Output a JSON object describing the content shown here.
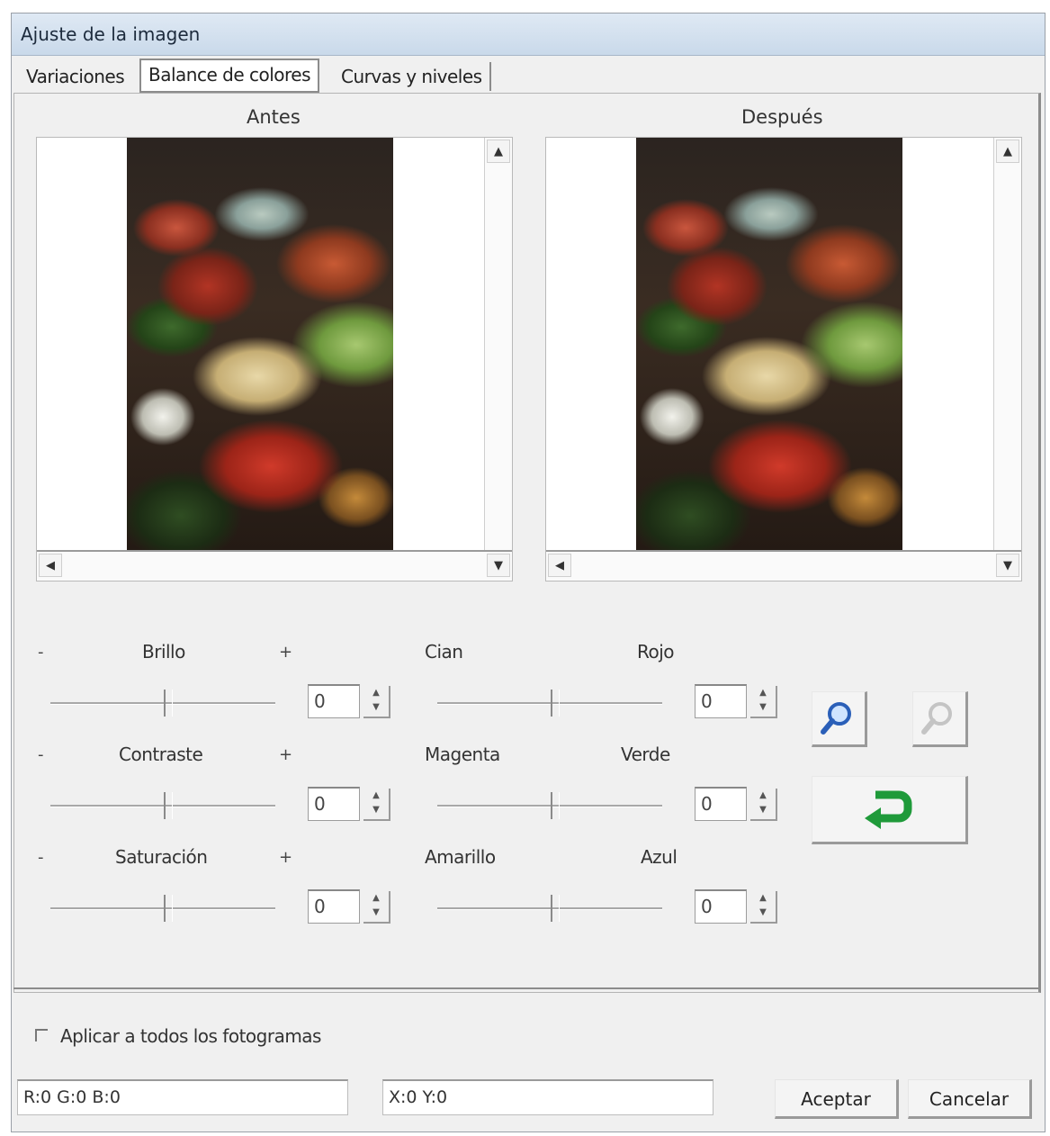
{
  "window": {
    "title": "Ajuste de la imagen"
  },
  "tabs": [
    {
      "label": "Variaciones",
      "active": false
    },
    {
      "label": "Balance de colores",
      "active": true
    },
    {
      "label": "Curvas y niveles",
      "active": false
    }
  ],
  "preview": {
    "before_label": "Antes",
    "after_label": "Después"
  },
  "adjustments": {
    "brightness": {
      "label": "Brillo",
      "minus": "-",
      "plus": "+",
      "value": "0"
    },
    "contrast": {
      "label": "Contraste",
      "minus": "-",
      "plus": "+",
      "value": "0"
    },
    "saturation": {
      "label": "Saturación",
      "minus": "-",
      "plus": "+",
      "value": "0"
    },
    "cyan_red": {
      "left": "Cian",
      "right": "Rojo",
      "value": "0"
    },
    "magenta_green": {
      "left": "Magenta",
      "right": "Verde",
      "value": "0"
    },
    "yellow_blue": {
      "left": "Amarillo",
      "right": "Azul",
      "value": "0"
    }
  },
  "apply_all": {
    "label": "Aplicar a todos los fotogramas",
    "checked": false
  },
  "status": {
    "rgb": "R:0 G:0 B:0",
    "xy": "X:0 Y:0"
  },
  "buttons": {
    "ok": "Aceptar",
    "cancel": "Cancelar"
  },
  "colors": {
    "titlebar": "#c9d9ea",
    "dialog_bg": "#f0f0f0",
    "undo_arrow": "#1f9a3a",
    "zoom_icon": "#2a5fb8"
  }
}
